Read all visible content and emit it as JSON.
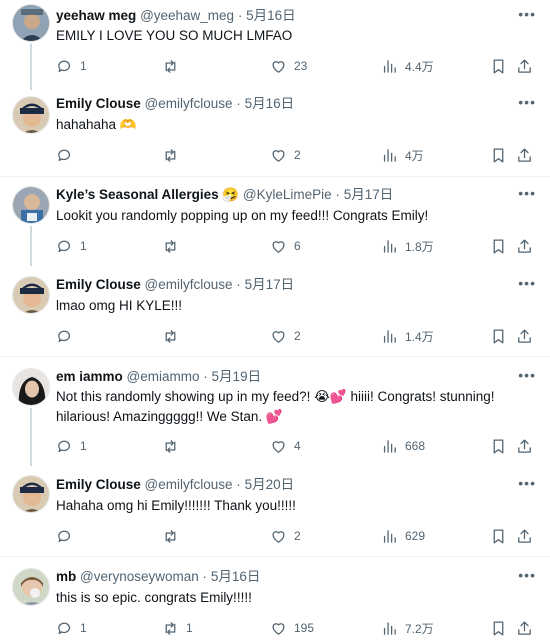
{
  "tweets": [
    {
      "name": "yeehaw meg",
      "handle": "@yeehaw_meg",
      "date": "5月16日",
      "text": "EMILY I LOVE YOU SO MUCH LMFAO",
      "replies": "1",
      "retweets": "",
      "likes": "23",
      "views": "4.4万"
    },
    {
      "name": "Emily Clouse",
      "handle": "@emilyfclouse",
      "date": "5月16日",
      "text": "hahahaha 🫶",
      "replies": "",
      "retweets": "",
      "likes": "2",
      "views": "4万"
    },
    {
      "name": "Kyle’s Seasonal Allergies 🤧",
      "handle": "@KyleLimePie",
      "date": "5月17日",
      "text": "Lookit you randomly popping up on my feed!!! Congrats Emily!",
      "replies": "1",
      "retweets": "",
      "likes": "6",
      "views": "1.8万"
    },
    {
      "name": "Emily Clouse",
      "handle": "@emilyfclouse",
      "date": "5月17日",
      "text": "lmao omg HI KYLE!!!",
      "replies": "",
      "retweets": "",
      "likes": "2",
      "views": "1.4万"
    },
    {
      "name": "em iammo",
      "handle": "@emiammo",
      "date": "5月19日",
      "text": "Not this randomly showing up in my feed?! 😭💕 hiiii! Congrats! stunning! hilarious! Amazinggggg!! We Stan. 💕",
      "replies": "1",
      "retweets": "",
      "likes": "4",
      "views": "668"
    },
    {
      "name": "Emily Clouse",
      "handle": "@emilyfclouse",
      "date": "5月20日",
      "text": "Hahaha omg hi Emily!!!!!!! Thank you!!!!!",
      "replies": "",
      "retweets": "",
      "likes": "2",
      "views": "629"
    },
    {
      "name": "mb",
      "handle": "@verynoseywoman",
      "date": "5月16日",
      "text": "this is so epic. congrats Emily!!!!!",
      "replies": "1",
      "retweets": "1",
      "likes": "195",
      "views": "7.2万"
    }
  ],
  "dot": "·",
  "more_glyph": "•••",
  "colors": {
    "icon": "#536471",
    "thread_line": "#cfd9de"
  }
}
